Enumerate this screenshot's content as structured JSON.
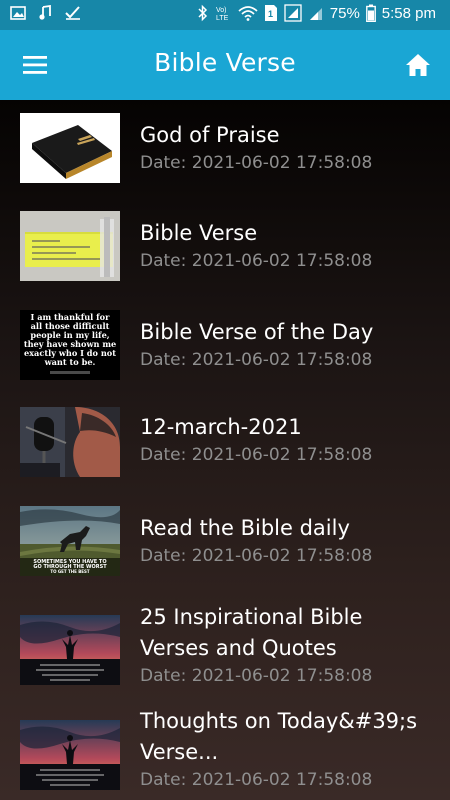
{
  "status_bar": {
    "battery_percent": "75%",
    "time": "5:58 pm",
    "left_icons": [
      "image-icon",
      "music-icon",
      "check-icon"
    ],
    "right_icons": [
      "bluetooth-icon",
      "volte-icon",
      "wifi-icon",
      "sim-icon",
      "signal-icon",
      "signal-icon",
      "battery-icon"
    ]
  },
  "app_bar": {
    "title": "Bible Verse",
    "menu_icon": "hamburger-menu-icon",
    "home_icon": "home-icon"
  },
  "items": [
    {
      "title": " God of Praise",
      "date": "Date: 2021-06-02 17:58:08",
      "thumb_icon": "holy-bible-book-image"
    },
    {
      "title": "Bible Verse",
      "date": "Date: 2021-06-02 17:58:08",
      "thumb_icon": "yellow-note-image"
    },
    {
      "title": "Bible Verse of the Day",
      "date": "Date: 2021-06-02 17:58:08",
      "thumb_icon": "thankful-quote-image",
      "thumb_text": [
        "I am thankful for",
        "all those difficult",
        "people in my life,",
        "they have shown me",
        "exactly who I do not",
        "want to be."
      ]
    },
    {
      "title": "12-march-2021",
      "date": "Date: 2021-06-02 17:58:08",
      "thumb_icon": "radio-microphone-image"
    },
    {
      "title": "Read the Bible daily",
      "date": "Date: 2021-06-02 17:58:08",
      "thumb_icon": "horse-field-image",
      "thumb_text": [
        "SOMETIMES YOU HAVE TO",
        "GO THROUGH THE WORST",
        "TO GET THE BEST"
      ]
    },
    {
      "title": "25 Inspirational Bible Verses and Quotes",
      "date": "Date: 2021-06-02 17:58:08",
      "thumb_icon": "man-sunset-image"
    },
    {
      "title": "Thoughts on Today&#39;s Verse...",
      "date": "Date: 2021-06-02 17:58:08",
      "thumb_icon": "man-sunset-image"
    }
  ]
}
